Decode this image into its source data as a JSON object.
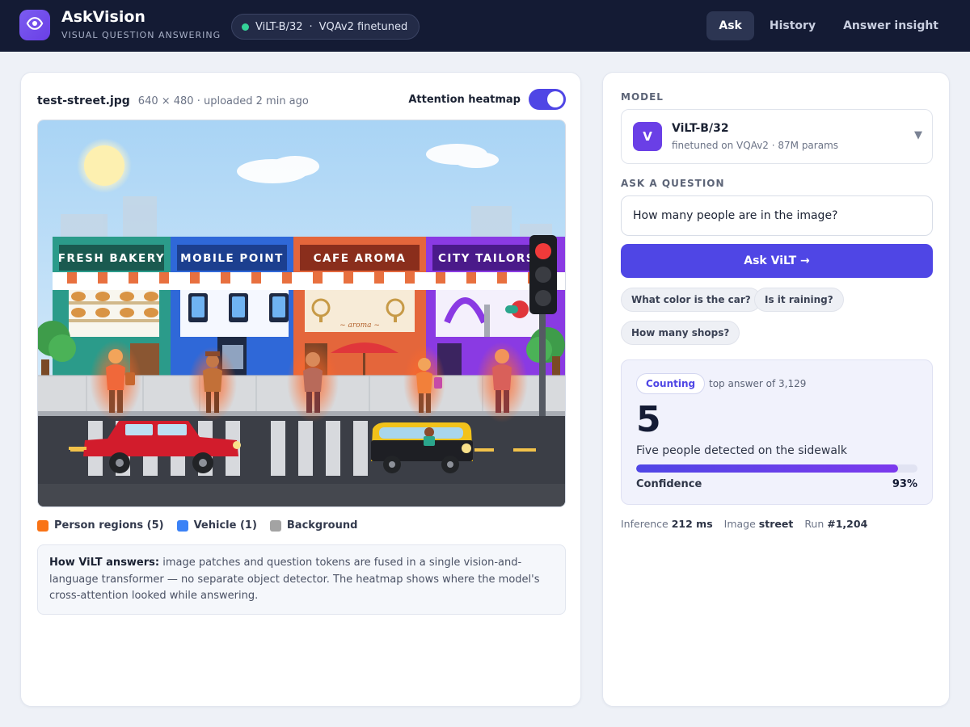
{
  "app": {
    "name": "AskVision",
    "subtitle": "VISUAL QUESTION ANSWERING",
    "logo_icon": "eye-icon"
  },
  "model_pill": {
    "model": "ViLT-B/32",
    "separator": "·",
    "variant": "VQAv2 finetuned",
    "status_color": "#34d399"
  },
  "nav": {
    "tabs": [
      {
        "label": "Ask",
        "active": true
      },
      {
        "label": "History",
        "active": false
      },
      {
        "label": "Answer insight",
        "active": false
      }
    ]
  },
  "image_panel": {
    "file_name": "test-street.jpg",
    "file_meta": "640 × 480 · uploaded 2 min ago",
    "heatmap_label": "Attention heatmap",
    "heatmap_on": true,
    "scene": {
      "shops": [
        "FRESH BAKERY",
        "MOBILE POINT",
        "CAFE AROMA",
        "CITY TAILORS"
      ],
      "cafe_script": "~ aroma ~"
    },
    "legend": [
      {
        "label": "Person regions (5)",
        "color": "#f97316"
      },
      {
        "label": "Vehicle (1)",
        "color": "#3b82f6"
      },
      {
        "label": "Background",
        "color": "#a3a3a3"
      }
    ],
    "note": {
      "lead": "How ViLT answers:",
      "body": " image patches and question tokens are fused in a single vision-and-language transformer — no separate object detector. The heatmap shows where the model's cross-attention looked while answering."
    }
  },
  "right_panel": {
    "model_section_label": "MODEL",
    "model": {
      "badge": "V",
      "name": "ViLT-B/32",
      "description": "finetuned on VQAv2 · 87M params",
      "chevron_icon": "chevron-down-icon"
    },
    "question_section_label": "ASK A QUESTION",
    "question_value": "How many people are in the image?",
    "ask_button": "Ask ViLT →",
    "suggestions": [
      "What color is the car?",
      "Is it raining?",
      "How many shops?"
    ],
    "answer": {
      "tag": "Counting",
      "top_answer_text": "top answer of 3,129",
      "value": "5",
      "description": "Five people detected on the sidewalk",
      "confidence_label": "Confidence",
      "confidence_text": "93%",
      "confidence": 0.93
    },
    "stats": {
      "inference_label": "Inference",
      "inference_value": "212 ms",
      "image_label": "Image",
      "image_value": "street",
      "run_label": "Run",
      "run_value": "#1,204"
    }
  },
  "colors": {
    "accent": "#4f46e5",
    "brand": "#6a3fe6",
    "topbar": "#141b34"
  }
}
